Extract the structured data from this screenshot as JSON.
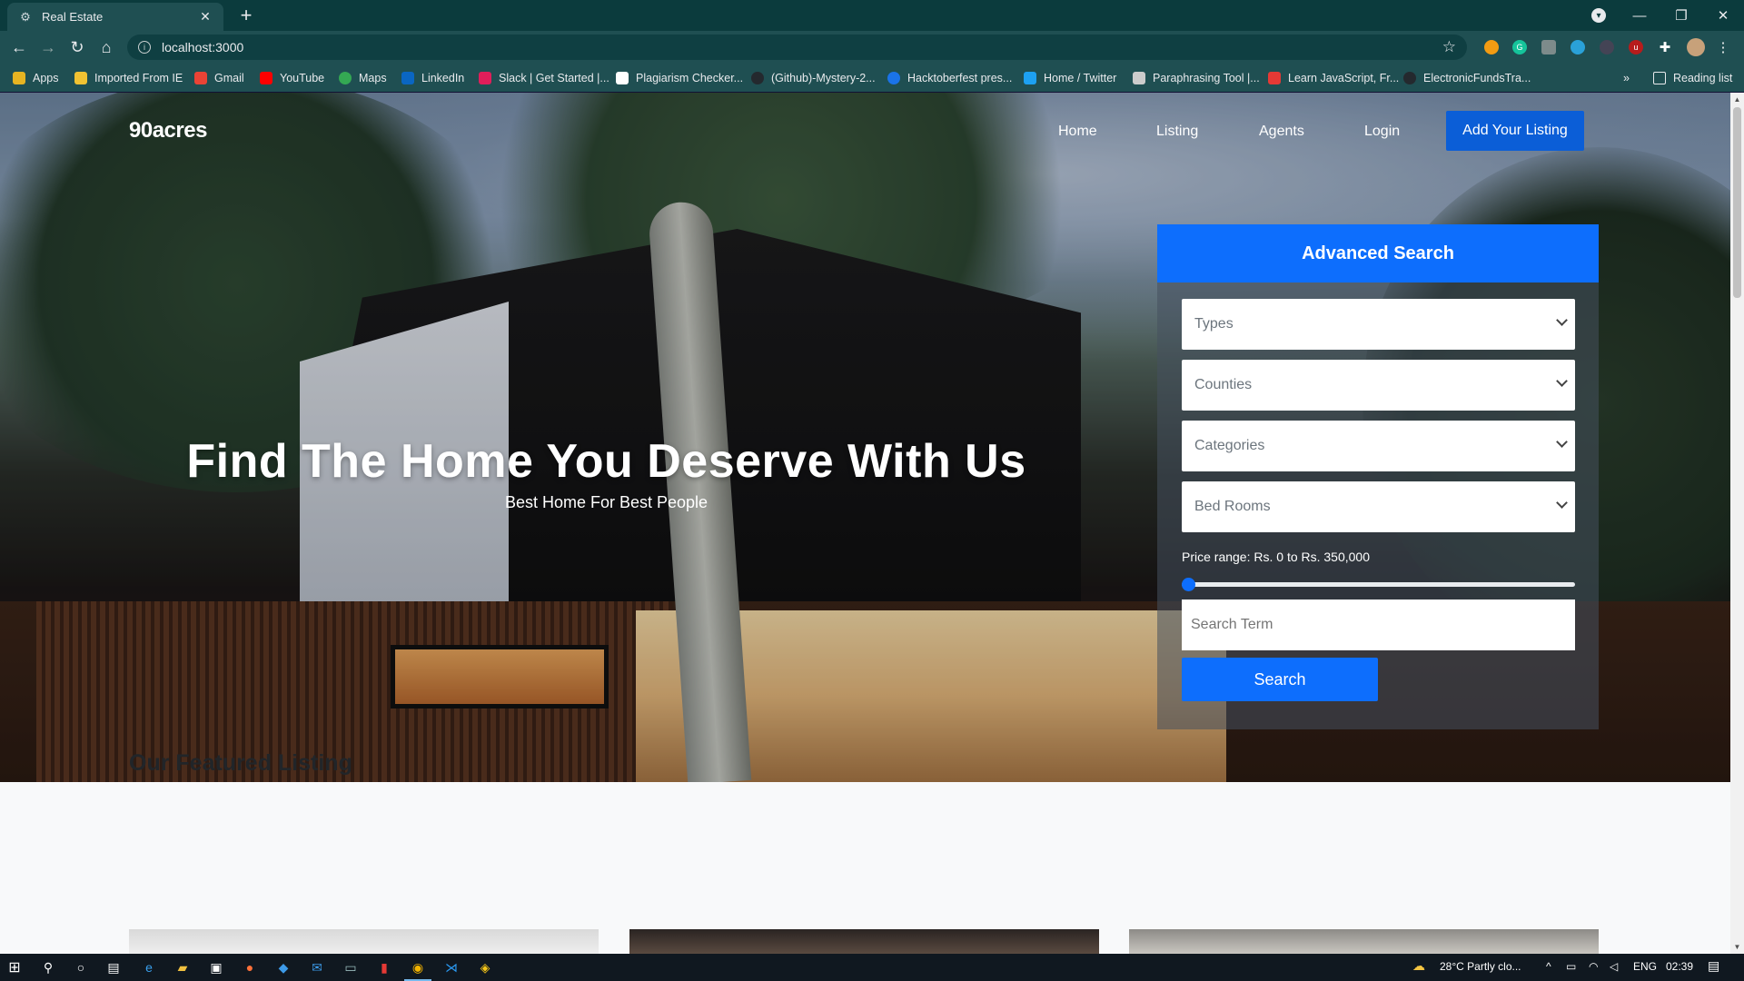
{
  "browser": {
    "tab_title": "Real Estate",
    "url": "localhost:3000",
    "bookmarks": [
      {
        "label": "Apps",
        "color": "#e6b422"
      },
      {
        "label": "Imported From IE",
        "color": "#f1c232"
      },
      {
        "label": "Gmail",
        "color": "#ea4335"
      },
      {
        "label": "YouTube",
        "color": "#ff0000"
      },
      {
        "label": "Maps",
        "color": "#34a853"
      },
      {
        "label": "LinkedIn",
        "color": "#0a66c2"
      },
      {
        "label": "Slack | Get Started |...",
        "color": "#e01e5a"
      },
      {
        "label": "Plagiarism Checker...",
        "color": "#ffffff"
      },
      {
        "label": "(Github)-Mystery-2...",
        "color": "#24292e"
      },
      {
        "label": "Hacktoberfest pres...",
        "color": "#1a73e8"
      },
      {
        "label": "Home / Twitter",
        "color": "#1da1f2"
      },
      {
        "label": "Paraphrasing Tool |...",
        "color": "#cccccc"
      },
      {
        "label": "Learn JavaScript, Fr...",
        "color": "#e53935"
      },
      {
        "label": "ElectronicFundsTra...",
        "color": "#24292e"
      }
    ],
    "reading_list": "Reading list"
  },
  "site": {
    "brand": "90acres",
    "nav": [
      "Home",
      "Listing",
      "Agents",
      "Login"
    ],
    "cta": "Add Your Listing",
    "headline": "Find The Home You Deserve With Us",
    "subheadline": "Best Home For Best People"
  },
  "search": {
    "title": "Advanced Search",
    "types": "Types",
    "counties": "Counties",
    "categories": "Categories",
    "bedrooms": "Bed Rooms",
    "price_label": "Price range: Rs. 0 to Rs. 350,000",
    "price_min_value": 0,
    "search_placeholder": "Search Term",
    "button": "Search"
  },
  "featured": {
    "title": "Our Featured Listing"
  },
  "taskbar": {
    "weather": "28°C  Partly clo...",
    "lang": "ENG",
    "time": "02:39"
  },
  "colors": {
    "accent": "#0d6efd",
    "chrome_tab": "#0b3b3d",
    "chrome_toolbar": "#1f4f52"
  }
}
